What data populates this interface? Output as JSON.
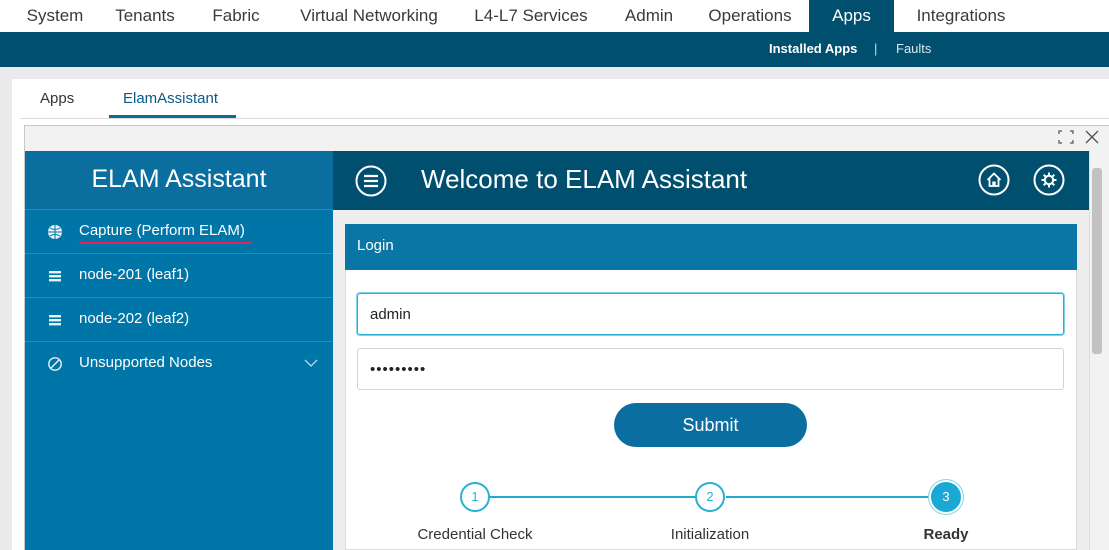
{
  "topnav": {
    "tabs": [
      {
        "label": "System"
      },
      {
        "label": "Tenants"
      },
      {
        "label": "Fabric"
      },
      {
        "label": "Virtual Networking"
      },
      {
        "label": "L4-L7 Services"
      },
      {
        "label": "Admin"
      },
      {
        "label": "Operations"
      },
      {
        "label": "Apps"
      },
      {
        "label": "Integrations"
      }
    ],
    "active": "Apps"
  },
  "subnav": {
    "installed_apps": "Installed Apps",
    "separator": "|",
    "faults": "Faults"
  },
  "apptabs": {
    "apps": "Apps",
    "elam": "ElamAssistant"
  },
  "sidebar": {
    "title": "ELAM Assistant",
    "items": [
      {
        "label": "Capture (Perform ELAM)",
        "icon": "globe-icon"
      },
      {
        "label": "node-201 (leaf1)",
        "icon": "server-icon"
      },
      {
        "label": "node-202 (leaf2)",
        "icon": "server-icon"
      },
      {
        "label": "Unsupported Nodes",
        "icon": "no-entry-icon"
      }
    ]
  },
  "header": {
    "welcome": "Welcome to ELAM Assistant"
  },
  "login": {
    "title": "Login",
    "username_value": "admin",
    "password_value": "•••••••••",
    "submit_label": "Submit"
  },
  "steps": [
    {
      "number": "1",
      "label": "Credential Check"
    },
    {
      "number": "2",
      "label": "Initialization"
    },
    {
      "number": "3",
      "label": "Ready"
    }
  ],
  "colors": {
    "nav_dark": "#004f6e",
    "sidebar": "#0076a8",
    "accent": "#28b0d2",
    "active_underline": "#e0245e"
  }
}
